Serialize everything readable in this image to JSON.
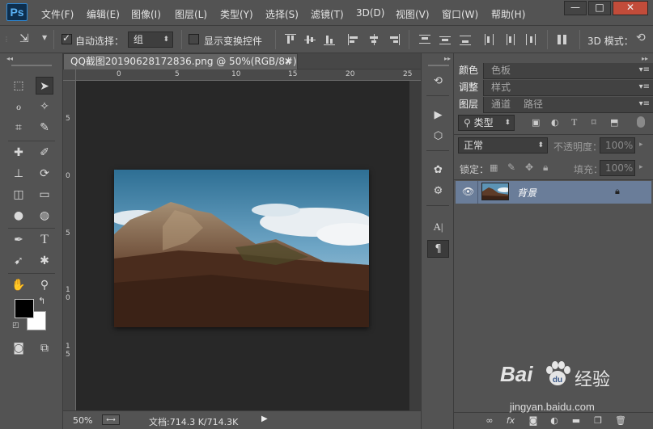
{
  "app": {
    "logo": "Ps"
  },
  "menu": [
    "文件(F)",
    "编辑(E)",
    "图像(I)",
    "图层(L)",
    "类型(Y)",
    "选择(S)",
    "滤镜(T)",
    "3D(D)",
    "视图(V)",
    "窗口(W)",
    "帮助(H)"
  ],
  "window_controls": {
    "minimize": "—",
    "maximize": "□",
    "close": "✕"
  },
  "options": {
    "auto_select_label": "自动选择：",
    "auto_select_checked": true,
    "auto_select_value": "组",
    "show_transform_label": "显示变换控件",
    "show_transform_checked": false,
    "mode_3d_label": "3D 模式："
  },
  "document": {
    "tab_title": "QQ截图20190628172836.png @ 50%(RGB/8#) *",
    "close": "✕",
    "ruler_top": [
      "0",
      "5",
      "10",
      "15",
      "20",
      "25"
    ],
    "ruler_left": [
      "5",
      "0",
      "5",
      "1 0",
      "1 5"
    ],
    "zoom": "50%",
    "doc_size": "文档:714.3 K/714.3K"
  },
  "panels": {
    "group1": [
      "颜色",
      "色板"
    ],
    "group2": [
      "调整",
      "样式"
    ],
    "layers_tabs": [
      "图层",
      "通道",
      "路径"
    ],
    "filter_kind": "类型",
    "blend_mode": "正常",
    "opacity_label": "不透明度：",
    "opacity_value": "100%",
    "lock_label": "锁定：",
    "fill_label": "填充：",
    "fill_value": "100%",
    "layer_name": "背景"
  },
  "watermark": {
    "brand": "Bai",
    "brand2": "经验",
    "url": "jingyan.baidu.com"
  },
  "colors": {
    "ui_bg": "#535353",
    "canvas_bg": "#282828",
    "accent": "#5ab1f3",
    "selected_layer": "#6a7d99"
  }
}
